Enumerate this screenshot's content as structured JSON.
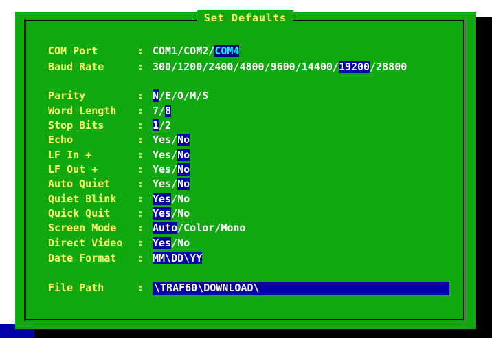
{
  "window": {
    "title": "Set Defaults"
  },
  "fields": [
    {
      "label": "COM Port",
      "options": [
        "COM1",
        "COM2",
        "COM4"
      ],
      "selected": 2
    },
    {
      "label": "Baud Rate",
      "options": [
        "300",
        "1200",
        "2400",
        "4800",
        "9600",
        "14400",
        "19200",
        "28800"
      ],
      "selected": 6
    },
    {
      "label": "Parity",
      "options": [
        "N",
        "E",
        "O",
        "M",
        "S"
      ],
      "selected": 0
    },
    {
      "label": "Word Length",
      "options": [
        "7",
        "8"
      ],
      "selected": 1
    },
    {
      "label": "Stop Bits",
      "options": [
        "1",
        "2"
      ],
      "selected": 0
    },
    {
      "label": "Echo",
      "options": [
        "Yes",
        "No"
      ],
      "selected": 1
    },
    {
      "label": "LF In +",
      "options": [
        "Yes",
        "No"
      ],
      "selected": 1
    },
    {
      "label": "LF Out +",
      "options": [
        "Yes",
        "No"
      ],
      "selected": 1
    },
    {
      "label": "Auto Quiet",
      "options": [
        "Yes",
        "No"
      ],
      "selected": 1
    },
    {
      "label": "Quiet Blink",
      "options": [
        "Yes",
        "No"
      ],
      "selected": 0
    },
    {
      "label": "Quick Quit",
      "options": [
        "Yes",
        "No"
      ],
      "selected": 0
    },
    {
      "label": "Screen Mode",
      "options": [
        "Auto",
        "Color",
        "Mono"
      ],
      "selected": 0
    },
    {
      "label": "Direct Video",
      "options": [
        "Yes",
        "No"
      ],
      "selected": 0
    },
    {
      "label": "Date Format",
      "options": [
        "MM\\DD\\YY"
      ],
      "selected": 0
    }
  ],
  "file_path": {
    "label": "File Path",
    "value": "\\TRAF60\\DOWNLOAD\\"
  },
  "colors": {
    "panel": "#11a811",
    "label": "#ffff66",
    "option": "#ffffff",
    "selected_bg": "#0000aa",
    "com_selected_fg": "#00ffff"
  }
}
